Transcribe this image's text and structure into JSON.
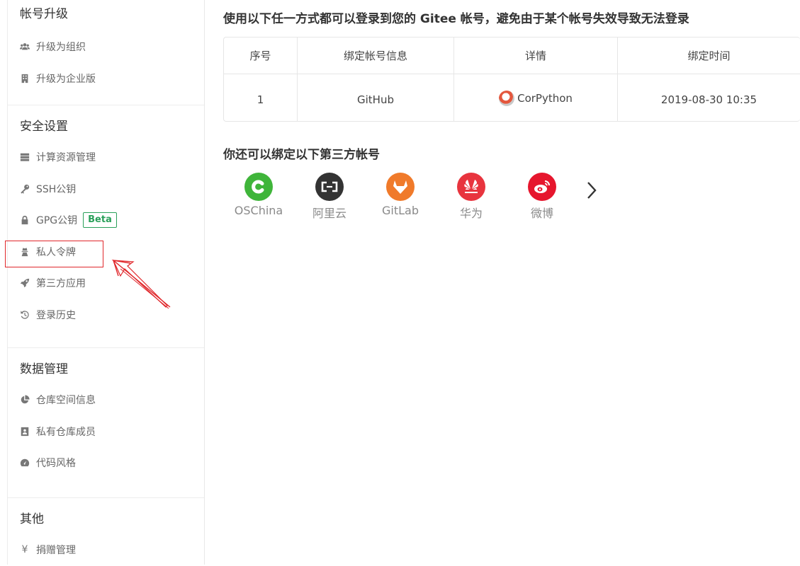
{
  "sidebar": {
    "sections": [
      {
        "title": "帐号升级",
        "items": [
          {
            "icon": "users-icon",
            "label": "升级为组织"
          },
          {
            "icon": "building-icon",
            "label": "升级为企业版"
          }
        ]
      },
      {
        "title": "安全设置",
        "items": [
          {
            "icon": "server-icon",
            "label": "计算资源管理"
          },
          {
            "icon": "key-icon",
            "label": "SSH公钥"
          },
          {
            "icon": "lock-icon",
            "label": "GPG公钥",
            "badge": "Beta"
          },
          {
            "icon": "user-secret-icon",
            "label": "私人令牌"
          },
          {
            "icon": "rocket-icon",
            "label": "第三方应用"
          },
          {
            "icon": "history-icon",
            "label": "登录历史"
          }
        ]
      },
      {
        "title": "数据管理",
        "items": [
          {
            "icon": "pie-chart-icon",
            "label": "仓库空间信息"
          },
          {
            "icon": "contact-book-icon",
            "label": "私有仓库成员"
          },
          {
            "icon": "dashboard-icon",
            "label": "代码风格"
          }
        ]
      },
      {
        "title": "其他",
        "items": [
          {
            "icon": "yen-icon",
            "label": "捐赠管理"
          }
        ]
      }
    ]
  },
  "main": {
    "heading": "使用以下任一方式都可以登录到您的 Gitee 帐号，避免由于某个帐号失效导致无法登录",
    "table": {
      "headers": [
        "序号",
        "绑定帐号信息",
        "详情",
        "绑定时间"
      ],
      "rows": [
        {
          "index": "1",
          "platform": "GitHub",
          "username": "CorPython",
          "time": "2019-08-30 10:35"
        }
      ]
    },
    "bind_heading": "你还可以绑定以下第三方帐号",
    "providers": [
      {
        "name": "OSChina",
        "color": "#3fb53a",
        "icon": "oschina-icon"
      },
      {
        "name": "阿里云",
        "color": "#333333",
        "icon": "aliyun-icon"
      },
      {
        "name": "GitLab",
        "color": "#f07a2a",
        "icon": "gitlab-icon"
      },
      {
        "name": "华为",
        "color": "#e8343e",
        "icon": "huawei-icon"
      },
      {
        "name": "微博",
        "color": "#e6162d",
        "icon": "weibo-icon"
      }
    ]
  },
  "colors": {
    "highlight_box": "#e0272b",
    "beta_badge": "#2aa05a"
  }
}
